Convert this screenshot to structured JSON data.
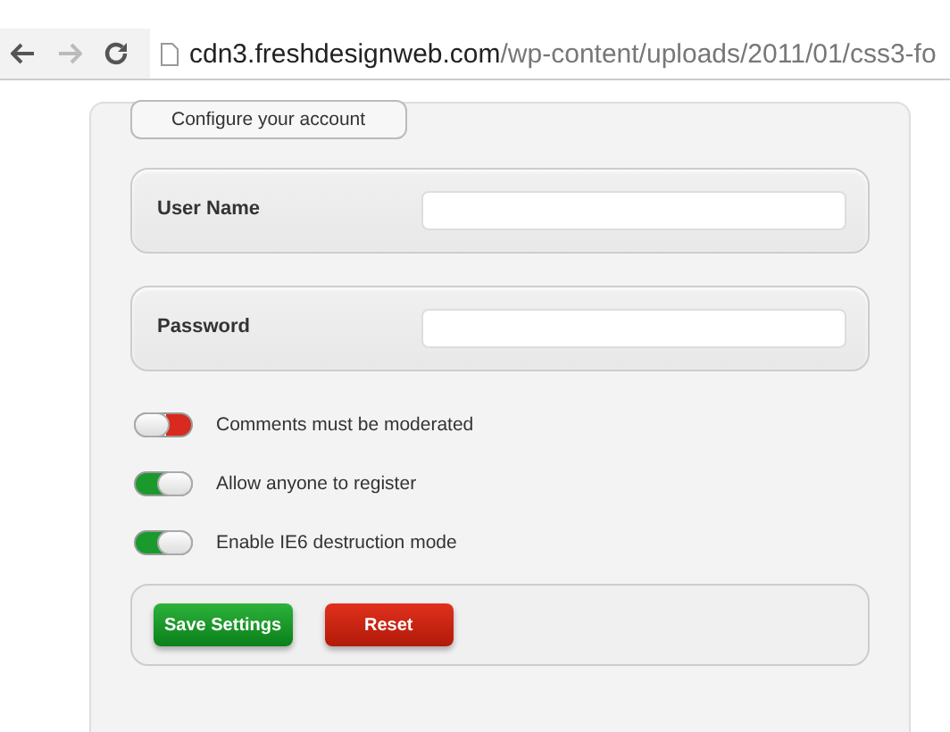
{
  "browser": {
    "url_host": "cdn3.freshdesignweb.com",
    "url_path": "/wp-content/uploads/2011/01/css3-fo",
    "forward_disabled": true
  },
  "form": {
    "legend": "Configure your account",
    "fields": [
      {
        "label": "User Name"
      },
      {
        "label": "Password"
      }
    ],
    "toggles": [
      {
        "label": "Comments must be moderated",
        "on": false
      },
      {
        "label": "Allow anyone to register",
        "on": true
      },
      {
        "label": "Enable IE6 destruction mode",
        "on": true
      }
    ],
    "buttons": [
      {
        "label": "Save Settings",
        "kind": "save"
      },
      {
        "label": "Reset",
        "kind": "reset"
      }
    ]
  }
}
